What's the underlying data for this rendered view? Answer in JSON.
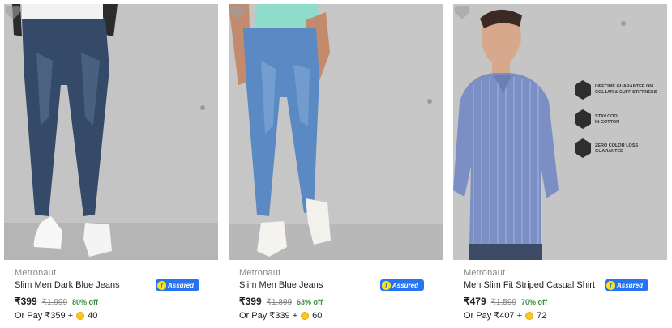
{
  "products": [
    {
      "brand": "Metronaut",
      "title": "Slim Men Dark Blue Jeans",
      "assured_label": "Assured",
      "price": "₹399",
      "mrp": "₹1,999",
      "discount": "80% off",
      "pay_prefix": "Or Pay ₹359 +",
      "coins": "40",
      "image_alt": "Dark blue jeans worn with white sneakers"
    },
    {
      "brand": "Metronaut",
      "title": "Slim Men Blue Jeans",
      "assured_label": "Assured",
      "price": "₹399",
      "mrp": "₹1,899",
      "discount": "63% off",
      "pay_prefix": "Or Pay ₹339 +",
      "coins": "60",
      "image_alt": "Light blue jeans worn with white sneakers"
    },
    {
      "brand": "Metronaut",
      "title": "Men Slim Fit Striped Casual Shirt",
      "assured_label": "Assured",
      "price": "₹479",
      "mrp": "₹1,599",
      "discount": "70% off",
      "pay_prefix": "Or Pay ₹407 +",
      "coins": "72",
      "image_alt": "Man wearing blue striped casual shirt",
      "features": [
        "LIFETIME GUARANTEE ON COLLAR & CUFF STIFFNESS",
        "STAY COOL IN COTTON",
        "ZERO COLOR LOSS GUARANTEE"
      ]
    }
  ],
  "colors": {
    "accent": "#2874f0",
    "discount": "#388e3c",
    "muted": "#878787",
    "coin": "#f9c623"
  }
}
